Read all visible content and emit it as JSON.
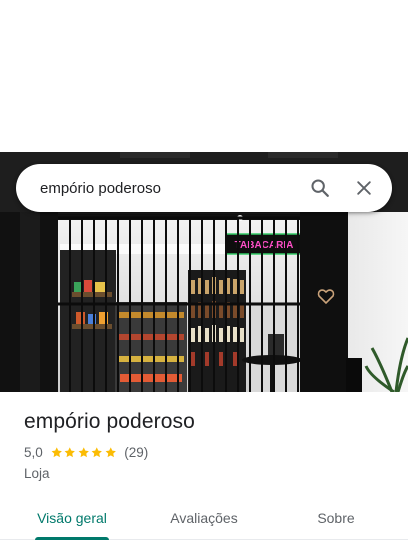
{
  "search": {
    "query": "empório poderoso",
    "search_icon": "search-icon",
    "close_icon": "close-icon"
  },
  "photo": {
    "sign_text": "TABACARIA"
  },
  "place": {
    "name": "empório poderoso",
    "rating": "5,0",
    "stars": 5,
    "review_count": "(29)",
    "category": "Loja"
  },
  "tabs": [
    {
      "label": "Visão geral",
      "active": true
    },
    {
      "label": "Avaliações",
      "active": false
    },
    {
      "label": "Sobre",
      "active": false
    }
  ],
  "colors": {
    "accent": "#00796b",
    "star": "#fbbc04",
    "text_secondary": "#5f6368"
  }
}
